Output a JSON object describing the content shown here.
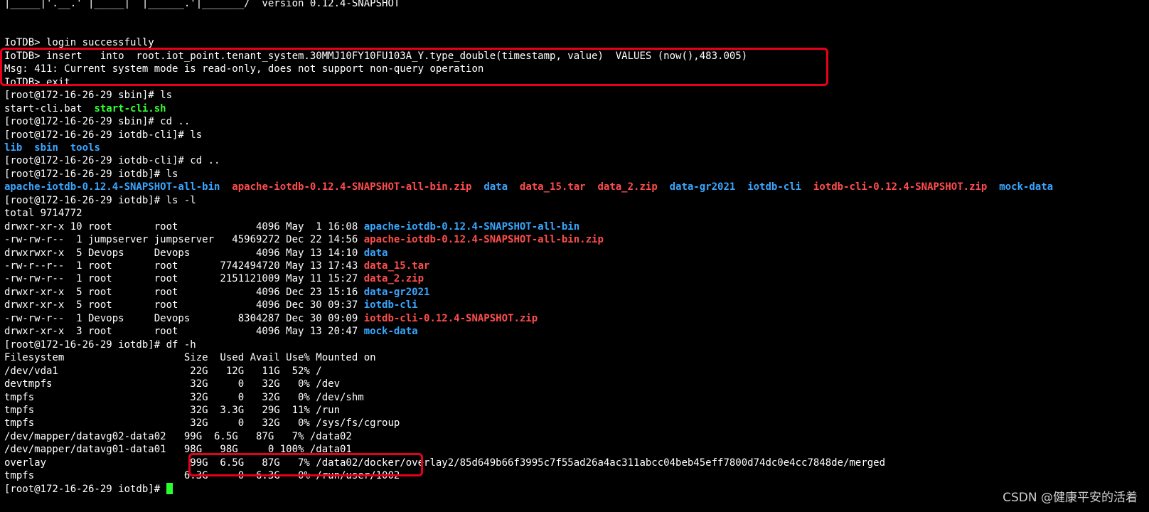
{
  "terminal": {
    "lines": [
      [
        {
          "t": "|_____|'.__.' |_____|  |______.'|_______/  version 0.12.4-SNAPSHOT",
          "c": "normal"
        }
      ],
      [
        {
          "t": "",
          "c": "normal"
        }
      ],
      [
        {
          "t": "",
          "c": "normal"
        }
      ],
      [
        {
          "t": "IoTDB> login successfully",
          "c": "normal"
        }
      ],
      [
        {
          "t": "IoTDB> insert   into  root.iot_point.tenant_system.30MMJ10FY10FU103A_Y.type_double(timestamp, value)  VALUES (now(),483.005)",
          "c": "normal"
        }
      ],
      [
        {
          "t": "Msg: 411: Current system mode is read-only, does not support non-query operation",
          "c": "normal"
        }
      ],
      [
        {
          "t": "IoTDB> exit",
          "c": "normal"
        }
      ],
      [
        {
          "t": "[root@172-16-26-29 sbin]# ls",
          "c": "normal"
        }
      ],
      [
        {
          "t": "start-cli.bat  ",
          "c": "normal"
        },
        {
          "t": "start-cli.sh",
          "c": "exec"
        }
      ],
      [
        {
          "t": "[root@172-16-26-29 sbin]# cd ..",
          "c": "normal"
        }
      ],
      [
        {
          "t": "[root@172-16-26-29 iotdb-cli]# ls",
          "c": "normal"
        }
      ],
      [
        {
          "t": "lib",
          "c": "dir"
        },
        {
          "t": "  ",
          "c": "normal"
        },
        {
          "t": "sbin",
          "c": "dir"
        },
        {
          "t": "  ",
          "c": "normal"
        },
        {
          "t": "tools",
          "c": "dir"
        }
      ],
      [
        {
          "t": "[root@172-16-26-29 iotdb-cli]# cd ..",
          "c": "normal"
        }
      ],
      [
        {
          "t": "[root@172-16-26-29 iotdb]# ls",
          "c": "normal"
        }
      ],
      [
        {
          "t": "apache-iotdb-0.12.4-SNAPSHOT-all-bin",
          "c": "dir"
        },
        {
          "t": "  ",
          "c": "normal"
        },
        {
          "t": "apache-iotdb-0.12.4-SNAPSHOT-all-bin.zip",
          "c": "archive"
        },
        {
          "t": "  ",
          "c": "normal"
        },
        {
          "t": "data",
          "c": "dir"
        },
        {
          "t": "  ",
          "c": "normal"
        },
        {
          "t": "data_15.tar",
          "c": "archive"
        },
        {
          "t": "  ",
          "c": "normal"
        },
        {
          "t": "data_2.zip",
          "c": "archive"
        },
        {
          "t": "  ",
          "c": "normal"
        },
        {
          "t": "data-gr2021",
          "c": "dir"
        },
        {
          "t": "  ",
          "c": "normal"
        },
        {
          "t": "iotdb-cli",
          "c": "dir"
        },
        {
          "t": "  ",
          "c": "normal"
        },
        {
          "t": "iotdb-cli-0.12.4-SNAPSHOT.zip",
          "c": "archive"
        },
        {
          "t": "  ",
          "c": "normal"
        },
        {
          "t": "mock-data",
          "c": "dir"
        }
      ],
      [
        {
          "t": "[root@172-16-26-29 iotdb]# ls -l",
          "c": "normal"
        }
      ],
      [
        {
          "t": "total 9714772",
          "c": "normal"
        }
      ],
      [
        {
          "t": "drwxr-xr-x 10 root       root             4096 May  1 16:08 ",
          "c": "normal"
        },
        {
          "t": "apache-iotdb-0.12.4-SNAPSHOT-all-bin",
          "c": "dir"
        }
      ],
      [
        {
          "t": "-rw-rw-r--  1 jumpserver jumpserver   45969272 Dec 22 14:56 ",
          "c": "normal"
        },
        {
          "t": "apache-iotdb-0.12.4-SNAPSHOT-all-bin.zip",
          "c": "archive"
        }
      ],
      [
        {
          "t": "drwxrwxr-x  5 Devops     Devops           4096 May 13 14:10 ",
          "c": "normal"
        },
        {
          "t": "data",
          "c": "dir"
        }
      ],
      [
        {
          "t": "-rw-r--r--  1 root       root       7742494720 May 13 17:43 ",
          "c": "normal"
        },
        {
          "t": "data_15.tar",
          "c": "archive"
        }
      ],
      [
        {
          "t": "-rw-rw-r--  1 root       root       2151121009 May 11 15:27 ",
          "c": "normal"
        },
        {
          "t": "data_2.zip",
          "c": "archive"
        }
      ],
      [
        {
          "t": "drwxr-xr-x  5 root       root             4096 Dec 23 15:16 ",
          "c": "normal"
        },
        {
          "t": "data-gr2021",
          "c": "dir"
        }
      ],
      [
        {
          "t": "drwxr-xr-x  5 root       root             4096 Dec 30 09:37 ",
          "c": "normal"
        },
        {
          "t": "iotdb-cli",
          "c": "dir"
        }
      ],
      [
        {
          "t": "-rw-rw-r--  1 Devops     Devops        8304287 Dec 30 09:09 ",
          "c": "normal"
        },
        {
          "t": "iotdb-cli-0.12.4-SNAPSHOT.zip",
          "c": "archive"
        }
      ],
      [
        {
          "t": "drwxr-xr-x  3 root       root             4096 May 13 20:47 ",
          "c": "normal"
        },
        {
          "t": "mock-data",
          "c": "dir"
        }
      ],
      [
        {
          "t": "[root@172-16-26-29 iotdb]# df -h",
          "c": "normal"
        }
      ],
      [
        {
          "t": "Filesystem                    Size  Used Avail Use% Mounted on",
          "c": "normal"
        }
      ],
      [
        {
          "t": "/dev/vda1                      22G   12G   11G  52% /",
          "c": "normal"
        }
      ],
      [
        {
          "t": "devtmpfs                       32G     0   32G   0% /dev",
          "c": "normal"
        }
      ],
      [
        {
          "t": "tmpfs                          32G     0   32G   0% /dev/shm",
          "c": "normal"
        }
      ],
      [
        {
          "t": "tmpfs                          32G  3.3G   29G  11% /run",
          "c": "normal"
        }
      ],
      [
        {
          "t": "tmpfs                          32G     0   32G   0% /sys/fs/cgroup",
          "c": "normal"
        }
      ],
      [
        {
          "t": "/dev/mapper/datavg02-data02   99G  6.5G   87G   7% /data02",
          "c": "normal"
        }
      ],
      [
        {
          "t": "/dev/mapper/datavg01-data01   98G   98G     0 100% /data01",
          "c": "normal"
        }
      ],
      [
        {
          "t": "overlay                        99G  6.5G   87G   7% /data02/docker/overlay2/85d649b66f3995c7f55ad26a4ac311abcc04beb45eff7800d74dc0e4cc7848de/merged",
          "c": "normal"
        }
      ],
      [
        {
          "t": "tmpfs                         6.3G     0  6.3G   0% /run/user/1002",
          "c": "normal"
        }
      ],
      [
        {
          "t": "[root@172-16-26-29 iotdb]# ",
          "c": "normal"
        }
      ]
    ]
  },
  "watermark": "CSDN @健康平安的活着",
  "colors": {
    "background": "#000000",
    "text": "#ffffff",
    "directory": "#3aa6ff",
    "archive": "#ff4d4d",
    "executable": "#33ff33",
    "highlight": "#e6001a"
  }
}
